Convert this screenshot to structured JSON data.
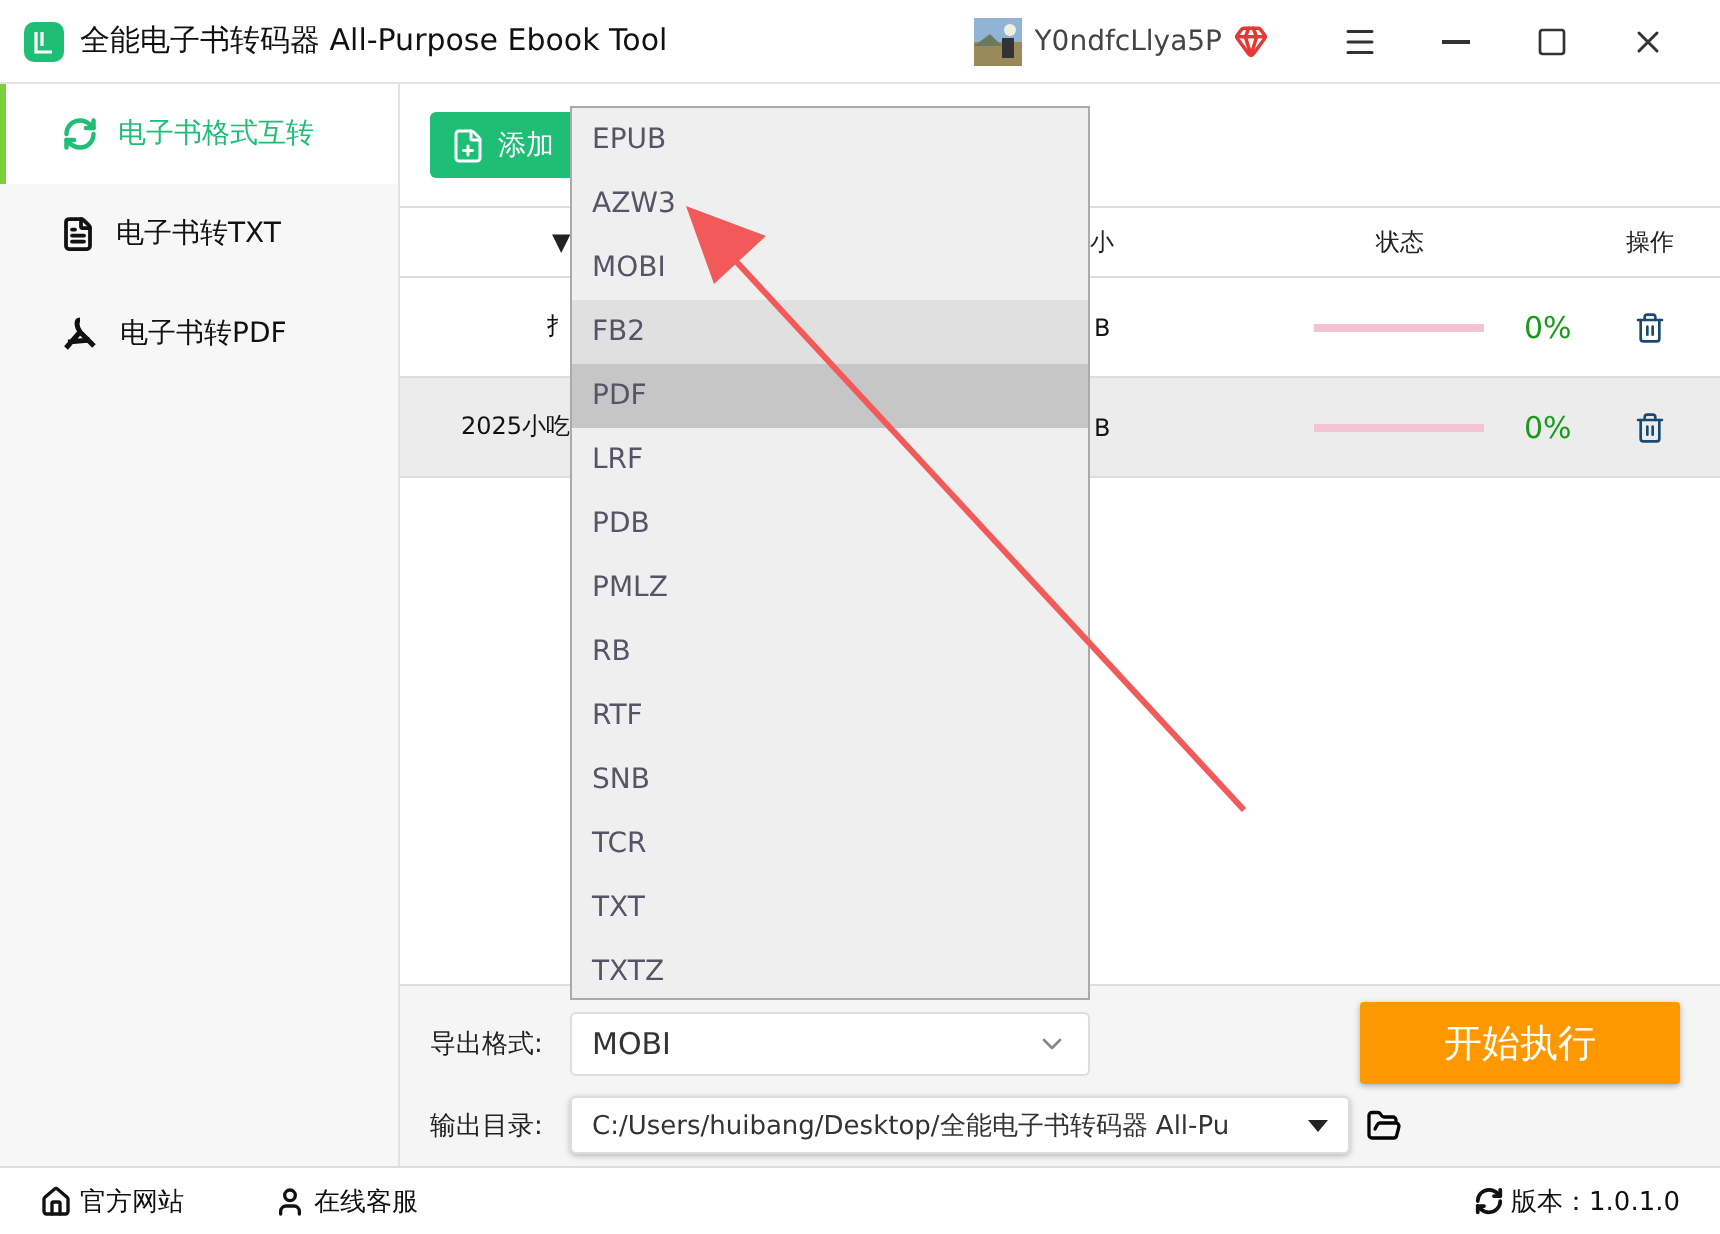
{
  "window": {
    "title": "全能电子书转码器 All-Purpose Ebook Tool",
    "user": "Y0ndfcLlya5P"
  },
  "sidebar": {
    "items": [
      {
        "label": "电子书格式互转",
        "selected": true
      },
      {
        "label": "电子书转TXT",
        "selected": false
      },
      {
        "label": "电子书转PDF",
        "selected": false
      }
    ]
  },
  "toolbar": {
    "add_button": "添加"
  },
  "table": {
    "columns": [
      {
        "label": "▼"
      },
      {
        "label": "小"
      },
      {
        "label": "状态"
      },
      {
        "label": "操作"
      }
    ],
    "rows": [
      {
        "name": "扌",
        "size": "B",
        "level": 0,
        "progress": "0%",
        "selected": false
      },
      {
        "name": "2025小吃",
        "size": "B",
        "level": 0,
        "progress": "0%",
        "selected": true
      }
    ]
  },
  "dropdown": {
    "options": [
      {
        "label": "EPUB",
        "hovered": false,
        "selected": false
      },
      {
        "label": "AZW3",
        "hovered": false,
        "selected": false
      },
      {
        "label": "MOBI",
        "hovered": false,
        "selected": false
      },
      {
        "label": "FB2",
        "hovered": true,
        "selected": false
      },
      {
        "label": "PDF",
        "hovered": false,
        "selected": true
      },
      {
        "label": "LRF",
        "hovered": false,
        "selected": false
      },
      {
        "label": "PDB",
        "hovered": false,
        "selected": false
      },
      {
        "label": "PMLZ",
        "hovered": false,
        "selected": false
      },
      {
        "label": "RB",
        "hovered": false,
        "selected": false
      },
      {
        "label": "RTF",
        "hovered": false,
        "selected": false
      },
      {
        "label": "SNB",
        "hovered": false,
        "selected": false
      },
      {
        "label": "TCR",
        "hovered": false,
        "selected": false
      },
      {
        "label": "TXT",
        "hovered": false,
        "selected": false
      },
      {
        "label": "TXTZ",
        "hovered": false,
        "selected": false
      }
    ]
  },
  "settings": {
    "format_label": "导出格式:",
    "format_value": "MOBI",
    "dir_label": "输出目录:",
    "dir_value": "C:/Users/huibang/Desktop/全能电子书转码器 All-Pu",
    "start_button": "开始执行"
  },
  "status_bar": {
    "website": "官方网站",
    "support": "在线客服",
    "version": "版本：1.0.1.0"
  }
}
